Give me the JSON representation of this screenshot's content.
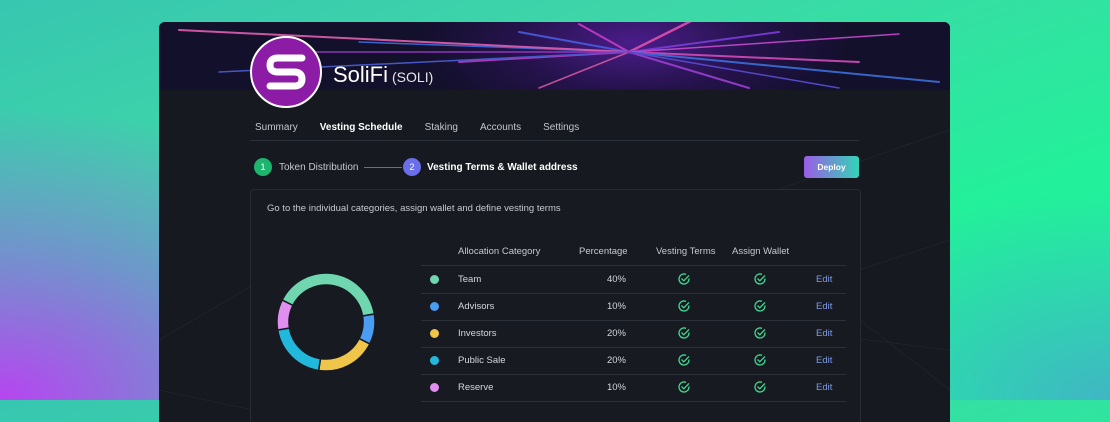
{
  "project": {
    "name": "SoliFi",
    "ticker": "(SOLI)",
    "logo_letter": "S",
    "logo_color": "#8c1ba6"
  },
  "tabs": [
    {
      "label": "Summary",
      "active": false
    },
    {
      "label": "Vesting Schedule",
      "active": true
    },
    {
      "label": "Staking",
      "active": false
    },
    {
      "label": "Accounts",
      "active": false
    },
    {
      "label": "Settings",
      "active": false
    }
  ],
  "stepper": {
    "steps": [
      {
        "number": "1",
        "label": "Token Distribution",
        "color": "#1db46e"
      },
      {
        "number": "2",
        "label": "Vesting Terms & Wallet address",
        "color": "#6a6ee8"
      }
    ]
  },
  "deploy_label": "Deploy",
  "instruction": "Go to the individual categories, assign wallet and define vesting terms",
  "table": {
    "columns": [
      "Allocation Category",
      "Percentage",
      "Vesting Terms",
      "Assign Wallet"
    ],
    "edit_label": "Edit",
    "rows": [
      {
        "category": "Team",
        "percentage": "40%",
        "value": 40,
        "color": "#6fd6b0",
        "vesting_terms": "check-circle-icon",
        "assign_wallet": "check-circle-icon"
      },
      {
        "category": "Advisors",
        "percentage": "10%",
        "value": 10,
        "color": "#4a9df0",
        "vesting_terms": "check-circle-icon",
        "assign_wallet": "check-circle-icon"
      },
      {
        "category": "Investors",
        "percentage": "20%",
        "value": 20,
        "color": "#f0c64a",
        "vesting_terms": "check-circle-icon",
        "assign_wallet": "check-circle-icon"
      },
      {
        "category": "Public Sale",
        "percentage": "20%",
        "value": 20,
        "color": "#22b8dc",
        "vesting_terms": "check-circle-icon",
        "assign_wallet": "check-circle-icon"
      },
      {
        "category": "Reserve",
        "percentage": "10%",
        "value": 10,
        "color": "#e08ef0",
        "vesting_terms": "check-circle-icon",
        "assign_wallet": "check-circle-icon"
      }
    ]
  },
  "colors": {
    "accent_check": "#3fd78f",
    "edit_link": "#7f9ce8"
  }
}
